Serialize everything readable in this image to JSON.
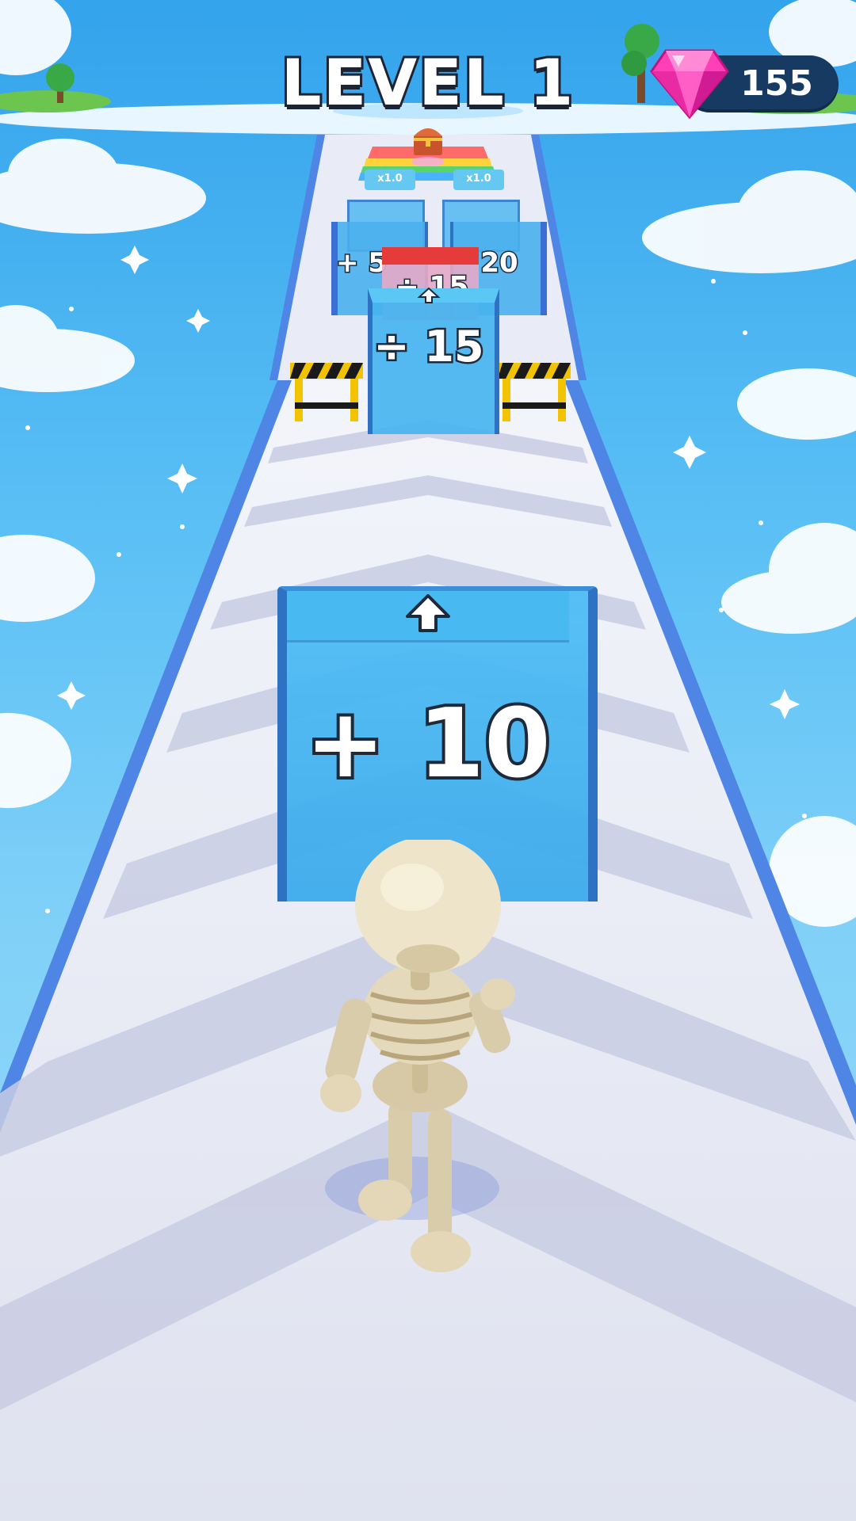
{
  "hud": {
    "level_label": "LEVEL 1",
    "gem_count": "155",
    "gem_icon": "pink-diamond-gem-icon"
  },
  "track": {
    "near_gate": {
      "label": "+ 10",
      "icon": "arrow-up-icon"
    },
    "mid_gate": {
      "label": "÷ 15",
      "icon": "arrow-up-icon"
    },
    "far_gate_left": {
      "label": "+ 5"
    },
    "far_gate_right": {
      "label": "20"
    },
    "far_gate_behind": {
      "label": "÷ 15"
    },
    "multiplier_left": "x1.0",
    "multiplier_right": "x1.0",
    "chest": "treasure-chest-icon"
  },
  "colors": {
    "sky": "#33a3ec",
    "track": "#e7e9f5",
    "track_edge": "#4f86e6",
    "gate": "#46b4ef",
    "hazard_yellow": "#f2c300",
    "gem": "#ff3fb8",
    "hud_pill": "#173a63"
  }
}
